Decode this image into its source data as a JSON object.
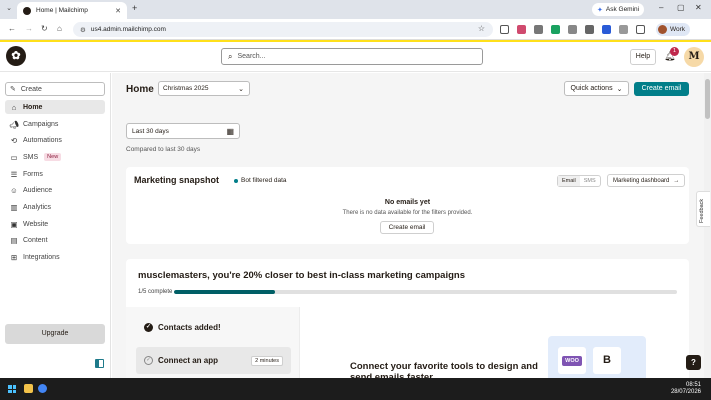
{
  "browser": {
    "tab_title": "Home | Mailchimp",
    "url": "us4.admin.mailchimp.com",
    "gemini_label": "Ask Gemini",
    "profile_label": "Work"
  },
  "header": {
    "search_placeholder": "Search...",
    "help_label": "Help",
    "notification_count": "1",
    "avatar_initial": "M"
  },
  "sidebar": {
    "create_label": "Create",
    "items": [
      {
        "label": "Home",
        "icon": "home-icon",
        "active": true
      },
      {
        "label": "Campaigns",
        "icon": "megaphone-icon"
      },
      {
        "label": "Automations",
        "icon": "automation-icon"
      },
      {
        "label": "SMS",
        "icon": "sms-icon",
        "badge": "New"
      },
      {
        "label": "Forms",
        "icon": "forms-icon"
      },
      {
        "label": "Audience",
        "icon": "audience-icon"
      },
      {
        "label": "Analytics",
        "icon": "analytics-icon"
      },
      {
        "label": "Website",
        "icon": "website-icon"
      },
      {
        "label": "Content",
        "icon": "content-icon"
      },
      {
        "label": "Integrations",
        "icon": "integrations-icon"
      }
    ],
    "upgrade_label": "Upgrade"
  },
  "main": {
    "title": "Home",
    "campaign_select": "Christmas 2025",
    "quick_actions_label": "Quick actions",
    "create_email_label": "Create email",
    "date_range": "Last 30 days",
    "compared_text": "Compared to last 30 days",
    "snapshot": {
      "title": "Marketing snapshot",
      "bot_filter": "Bot filtered data",
      "seg_email": "Email",
      "seg_sms": "SMS",
      "dashboard_label": "Marketing dashboard",
      "empty_title": "No emails yet",
      "empty_desc": "There is no data available for the filters provided.",
      "create_label": "Create email"
    },
    "progress": {
      "title": "musclemasters, you're 20% closer to best in-class marketing campaigns",
      "count": "1/5 complete",
      "fraction": 0.2,
      "step_done": "Contacts added!",
      "step_current": "Connect an app",
      "step_time": "2 minutes",
      "connect_title": "Connect your favorite tools to design and send emails faster",
      "app_woo": "WOO",
      "app_bc": "B"
    },
    "feedback_label": "Feedback",
    "help_button": "?"
  },
  "taskbar": {
    "time": "08:51",
    "date": "28/07/2026"
  },
  "colors": {
    "accent": "#017e89",
    "progress_fill": "#005f66",
    "brand_yellow": "#ffe01b"
  }
}
